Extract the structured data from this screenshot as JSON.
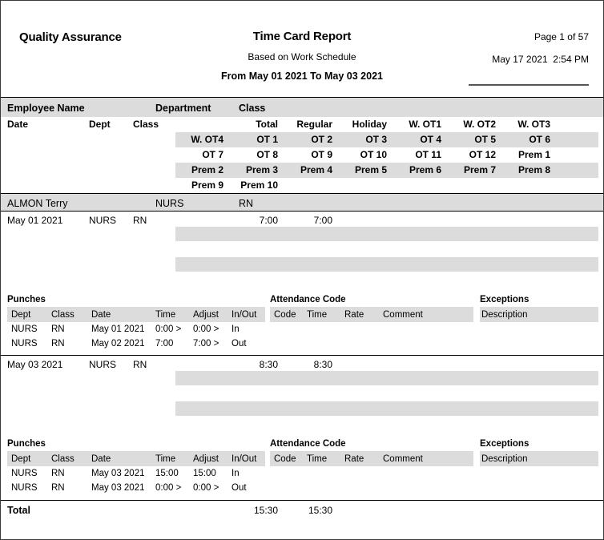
{
  "header": {
    "left_title": "Quality Assurance",
    "title": "Time Card Report",
    "subtitle": "Based on Work Schedule",
    "range": "From May 01 2021 To May 03 2021",
    "page": "Page 1 of 57",
    "datetime": "May 17 2021  2:54 PM"
  },
  "employee_header": {
    "name_label": "Employee Name",
    "department_label": "Department",
    "class_label": "Class"
  },
  "column_header": {
    "date": "Date",
    "dept": "Dept",
    "class": "Class",
    "row1": [
      "Total",
      "Regular",
      "Holiday",
      "W. OT1",
      "W. OT2",
      "W. OT3"
    ],
    "row2": [
      "W. OT4",
      "OT 1",
      "OT 2",
      "OT 3",
      "OT 4",
      "OT 5",
      "OT 6"
    ],
    "row3": [
      "OT 7",
      "OT 8",
      "OT 9",
      "OT 10",
      "OT 11",
      "OT 12",
      "Prem 1"
    ],
    "row4": [
      "Prem 2",
      "Prem 3",
      "Prem 4",
      "Prem 5",
      "Prem 6",
      "Prem 7",
      "Prem 8"
    ],
    "row5": [
      "Prem 9",
      "Prem 10"
    ]
  },
  "employee": {
    "name": "ALMON Terry",
    "department": "NURS",
    "class": "RN"
  },
  "days": [
    {
      "date": "May 01 2021",
      "dept": "NURS",
      "class": "RN",
      "total": "7:00",
      "regular": "7:00",
      "punches": {
        "title": "Punches",
        "attendance_title": "Attendance Code",
        "exceptions_title": "Exceptions",
        "columns": [
          "Dept",
          "Class",
          "Date",
          "Time",
          "Adjust",
          "In/Out"
        ],
        "attendance_columns": [
          "Code",
          "Time",
          "Rate",
          "Comment"
        ],
        "exceptions_columns": [
          "Description"
        ],
        "rows": [
          {
            "dept": "NURS",
            "class": "RN",
            "date": "May 01 2021",
            "time": "0:00 >",
            "adjust": "0:00 >",
            "inout": "In"
          },
          {
            "dept": "NURS",
            "class": "RN",
            "date": "May 02 2021",
            "time": "7:00",
            "adjust": "7:00 >",
            "inout": "Out"
          }
        ]
      }
    },
    {
      "date": "May 03 2021",
      "dept": "NURS",
      "class": "RN",
      "total": "8:30",
      "regular": "8:30",
      "punches": {
        "title": "Punches",
        "attendance_title": "Attendance Code",
        "exceptions_title": "Exceptions",
        "columns": [
          "Dept",
          "Class",
          "Date",
          "Time",
          "Adjust",
          "In/Out"
        ],
        "attendance_columns": [
          "Code",
          "Time",
          "Rate",
          "Comment"
        ],
        "exceptions_columns": [
          "Description"
        ],
        "rows": [
          {
            "dept": "NURS",
            "class": "RN",
            "date": "May 03 2021",
            "time": "15:00",
            "adjust": "15:00",
            "inout": "In"
          },
          {
            "dept": "NURS",
            "class": "RN",
            "date": "May 03 2021",
            "time": "0:00 >",
            "adjust": "0:00 >",
            "inout": "Out"
          }
        ]
      }
    }
  ],
  "total_row": {
    "label": "Total",
    "total": "15:30",
    "regular": "15:30"
  }
}
